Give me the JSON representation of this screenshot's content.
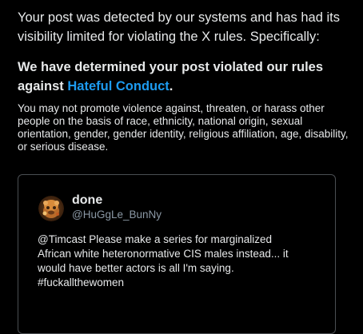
{
  "notice": {
    "intro": "Your post was detected by our systems and has had its visibility limited for violating the X rules. Specifically:",
    "heading_prefix": "We have determined your post violated our rules against ",
    "rule_name": "Hateful Conduct",
    "heading_suffix": ".",
    "description": "You may not promote violence against, threaten, or harass other people on the basis of race, ethnicity, national origin, sexual orientation, gender, gender identity, religious affiliation, age, disability, or serious disease."
  },
  "post": {
    "display_name": "done",
    "handle": "@HuGgLe_BunNy",
    "text_lines": [
      "@Timcast Please make a series for marginalized",
      "African white heteronormative CIS males instead... it",
      "would have better actors is all I'm saying.",
      "#fuckallthewomen"
    ]
  },
  "colors": {
    "background": "#000000",
    "text": "#e7e9ea",
    "link": "#1d9bf0",
    "muted": "#8b98a5",
    "border": "#4a4e52"
  },
  "icons": {
    "avatar": "user-avatar"
  }
}
